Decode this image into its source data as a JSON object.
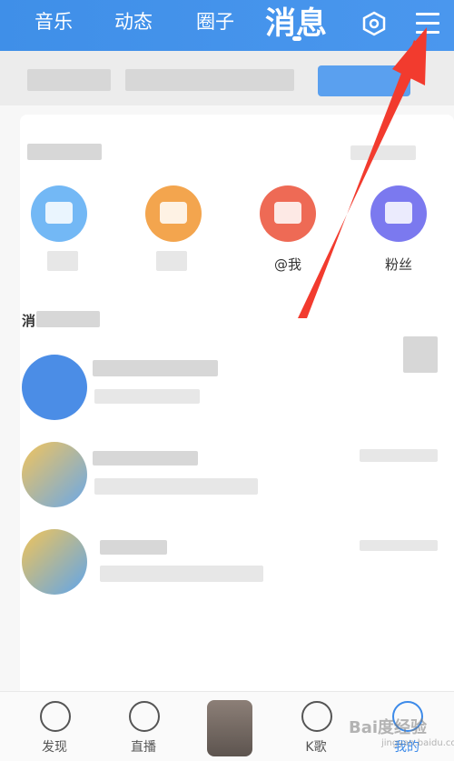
{
  "top_nav": {
    "tabs": [
      {
        "label": "音乐"
      },
      {
        "label": "动态"
      },
      {
        "label": "圈子"
      },
      {
        "label": "消息"
      }
    ],
    "settings_icon": "hexagon-settings-icon",
    "menu_icon": "hamburger-menu-icon"
  },
  "quick_actions": {
    "items": [
      {
        "label": ""
      },
      {
        "label": ""
      },
      {
        "label": "@我"
      },
      {
        "label": "粉丝"
      }
    ]
  },
  "section_label": "消",
  "bottom_nav": {
    "items": [
      {
        "label": "发现"
      },
      {
        "label": "直播"
      },
      {
        "label": "K歌"
      },
      {
        "label": "我的"
      }
    ]
  },
  "watermark": {
    "text": "Bai度经验",
    "sub": "jingyan.baidu.com"
  },
  "colors": {
    "accent": "#3c8ae9",
    "annotation_arrow": "#f23b2e"
  }
}
